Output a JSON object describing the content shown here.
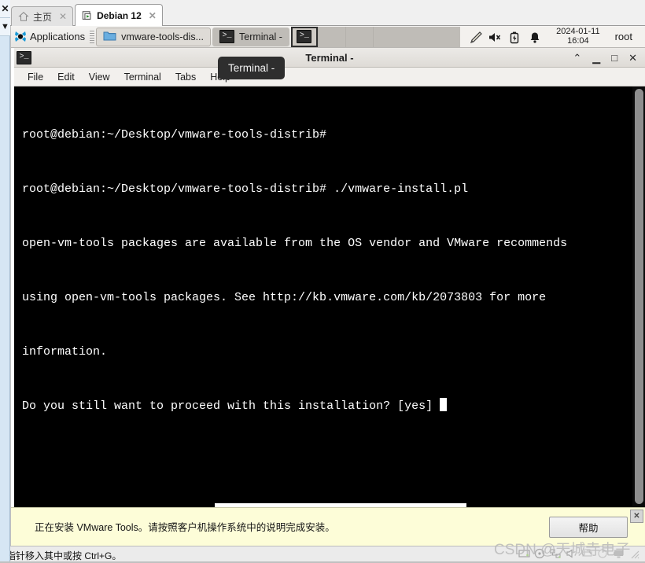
{
  "vmware": {
    "tabs": [
      {
        "label": "主页",
        "icon": "home-icon",
        "active": false
      },
      {
        "label": "Debian 12",
        "icon": "vm-icon",
        "active": true
      }
    ],
    "close_glyph": "✕",
    "rail": {
      "close_glyph": "✕",
      "dropdown_glyph": "▼"
    },
    "notification": {
      "message": "正在安装 VMware Tools。请按照客户机操作系统中的说明完成安装。",
      "help_label": "帮助",
      "close_glyph": "✕"
    },
    "statusbar": {
      "hint": "标指针移入其中或按 Ctrl+G。"
    },
    "watermark": "CSDN @天城寺电子"
  },
  "xfce": {
    "applications_label": "Applications",
    "taskbar_buttons": [
      {
        "label": "vmware-tools-dis...",
        "icon": "folder-icon",
        "style": "raised"
      },
      {
        "label": "Terminal -",
        "icon": "terminal-icon",
        "style": "flat"
      }
    ],
    "tray_icons": [
      "screenshot-tool-icon",
      "volume-muted-icon",
      "battery-icon",
      "notification-bell-icon"
    ],
    "clock": {
      "date": "2024-01-11",
      "time": "16:04"
    },
    "user": "root"
  },
  "terminal": {
    "title": "Terminal -",
    "icon": "terminal-icon",
    "menu": [
      "File",
      "Edit",
      "View",
      "Terminal",
      "Tabs",
      "Help"
    ],
    "window_controls": {
      "shade": "⌃",
      "minimize": "▁",
      "maximize": "□",
      "close": "✕"
    },
    "lines": [
      "root@debian:~/Desktop/vmware-tools-distrib# ",
      "root@debian:~/Desktop/vmware-tools-distrib# ./vmware-install.pl",
      "open-vm-tools packages are available from the OS vendor and VMware recommends",
      "using open-vm-tools packages. See http://kb.vmware.com/kb/2073803 for more",
      "information.",
      "Do you still want to proceed with this installation? [yes] "
    ]
  },
  "tooltip": {
    "text": "Terminal -"
  },
  "colors": {
    "terminal_bg": "#000000",
    "terminal_fg": "#ffffff",
    "notify_bg": "#fdfdd8",
    "panel_bg": "#f3f1ee",
    "accent_tab": "#ffffff"
  }
}
